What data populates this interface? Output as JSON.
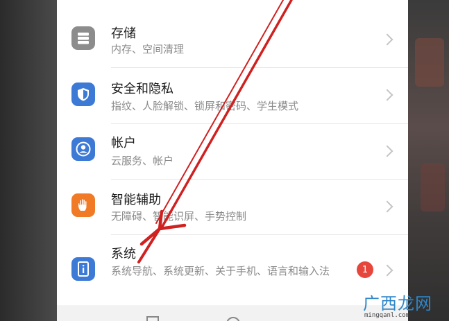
{
  "settings": {
    "items": [
      {
        "title": "存储",
        "subtitle": "内存、空间清理",
        "icon": "storage-icon",
        "color": "#8c8c8c"
      },
      {
        "title": "安全和隐私",
        "subtitle": "指纹、人脸解锁、锁屏和密码、学生模式",
        "icon": "shield-icon",
        "color": "#3d7ad6"
      },
      {
        "title": "帐户",
        "subtitle": "云服务、帐户",
        "icon": "account-icon",
        "color": "#3d7ad6"
      },
      {
        "title": "智能辅助",
        "subtitle": "无障碍、智能识屏、手势控制",
        "icon": "hand-icon",
        "color": "#f07a25"
      },
      {
        "title": "系统",
        "subtitle": "系统导航、系统更新、关于手机、语言和输入法",
        "icon": "system-info-icon",
        "color": "#3d7ad6",
        "badge": "1"
      }
    ]
  },
  "watermark": {
    "text": "广西龙网",
    "url": "mingqanl.com"
  },
  "annotation_color": "#d0201f"
}
